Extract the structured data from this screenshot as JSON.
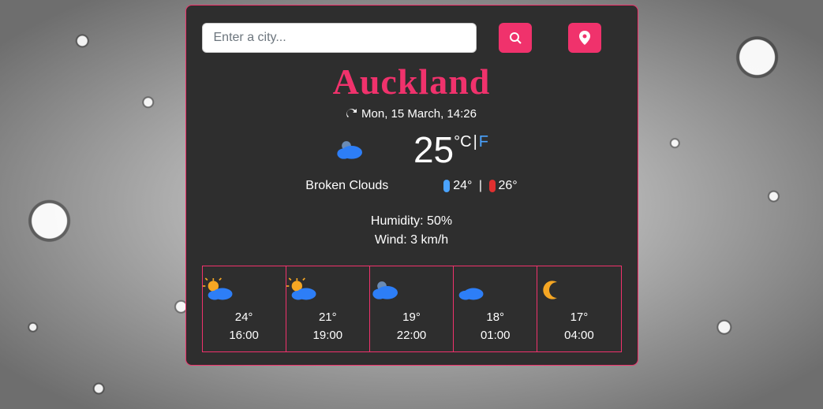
{
  "search": {
    "placeholder": "Enter a city..."
  },
  "city": "Auckland",
  "datetime": "Mon, 15 March, 14:26",
  "current": {
    "temp": "25",
    "unit_c": "C",
    "unit_f": "F",
    "description": "Broken Clouds",
    "low": "24°",
    "high": "26°",
    "humidity_label": "Humidity: 50%",
    "wind_label": "Wind: 3 km/h",
    "icon": "cloud"
  },
  "forecast": [
    {
      "icon": "sun-cloud",
      "temp": "24°",
      "time": "16:00"
    },
    {
      "icon": "sun-cloud",
      "temp": "21°",
      "time": "19:00"
    },
    {
      "icon": "cloud",
      "temp": "19°",
      "time": "22:00"
    },
    {
      "icon": "moon-cloud",
      "temp": "18°",
      "time": "01:00"
    },
    {
      "icon": "moon",
      "temp": "17°",
      "time": "04:00"
    }
  ],
  "colors": {
    "accent": "#f0326c",
    "link": "#4aa3ff"
  }
}
